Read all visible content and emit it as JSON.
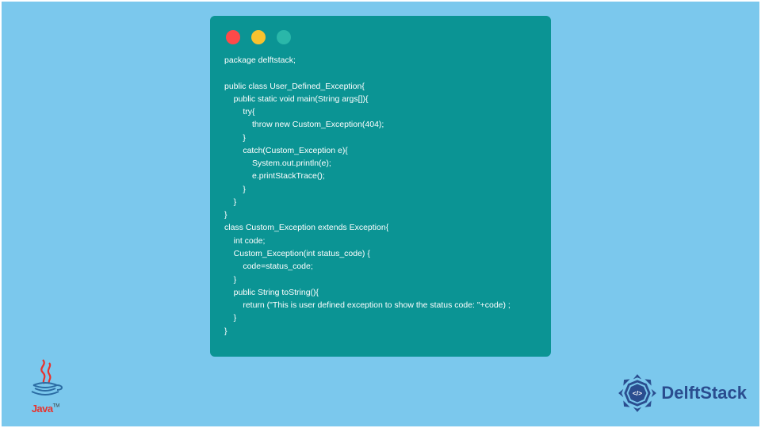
{
  "code": {
    "lines": [
      "package delftstack;",
      "",
      "public class User_Defined_Exception{",
      "    public static void main(String args[]){",
      "        try{",
      "            throw new Custom_Exception(404);",
      "        }",
      "        catch(Custom_Exception e){",
      "            System.out.println(e);",
      "            e.printStackTrace();",
      "        }",
      "    }",
      "}",
      "class Custom_Exception extends Exception{",
      "    int code;",
      "    Custom_Exception(int status_code) {",
      "        code=status_code;",
      "    }",
      "    public String toString(){",
      "        return (\"This is user defined exception to show the status code: \"+code) ;",
      "    }",
      "}"
    ]
  },
  "java_logo": {
    "label": "Java",
    "tm": "TM"
  },
  "delft_logo": {
    "label": "DelftStack"
  },
  "colors": {
    "page_bg": "#7bc8ed",
    "window_bg": "#0b9494",
    "code_text": "#ffffff",
    "traffic_red": "#fe4a49",
    "traffic_yellow": "#f9c22e",
    "traffic_green": "#2ab7a9",
    "java_red": "#e8322d",
    "java_blue": "#2b6ca3",
    "delft_blue": "#2a4d8f"
  }
}
